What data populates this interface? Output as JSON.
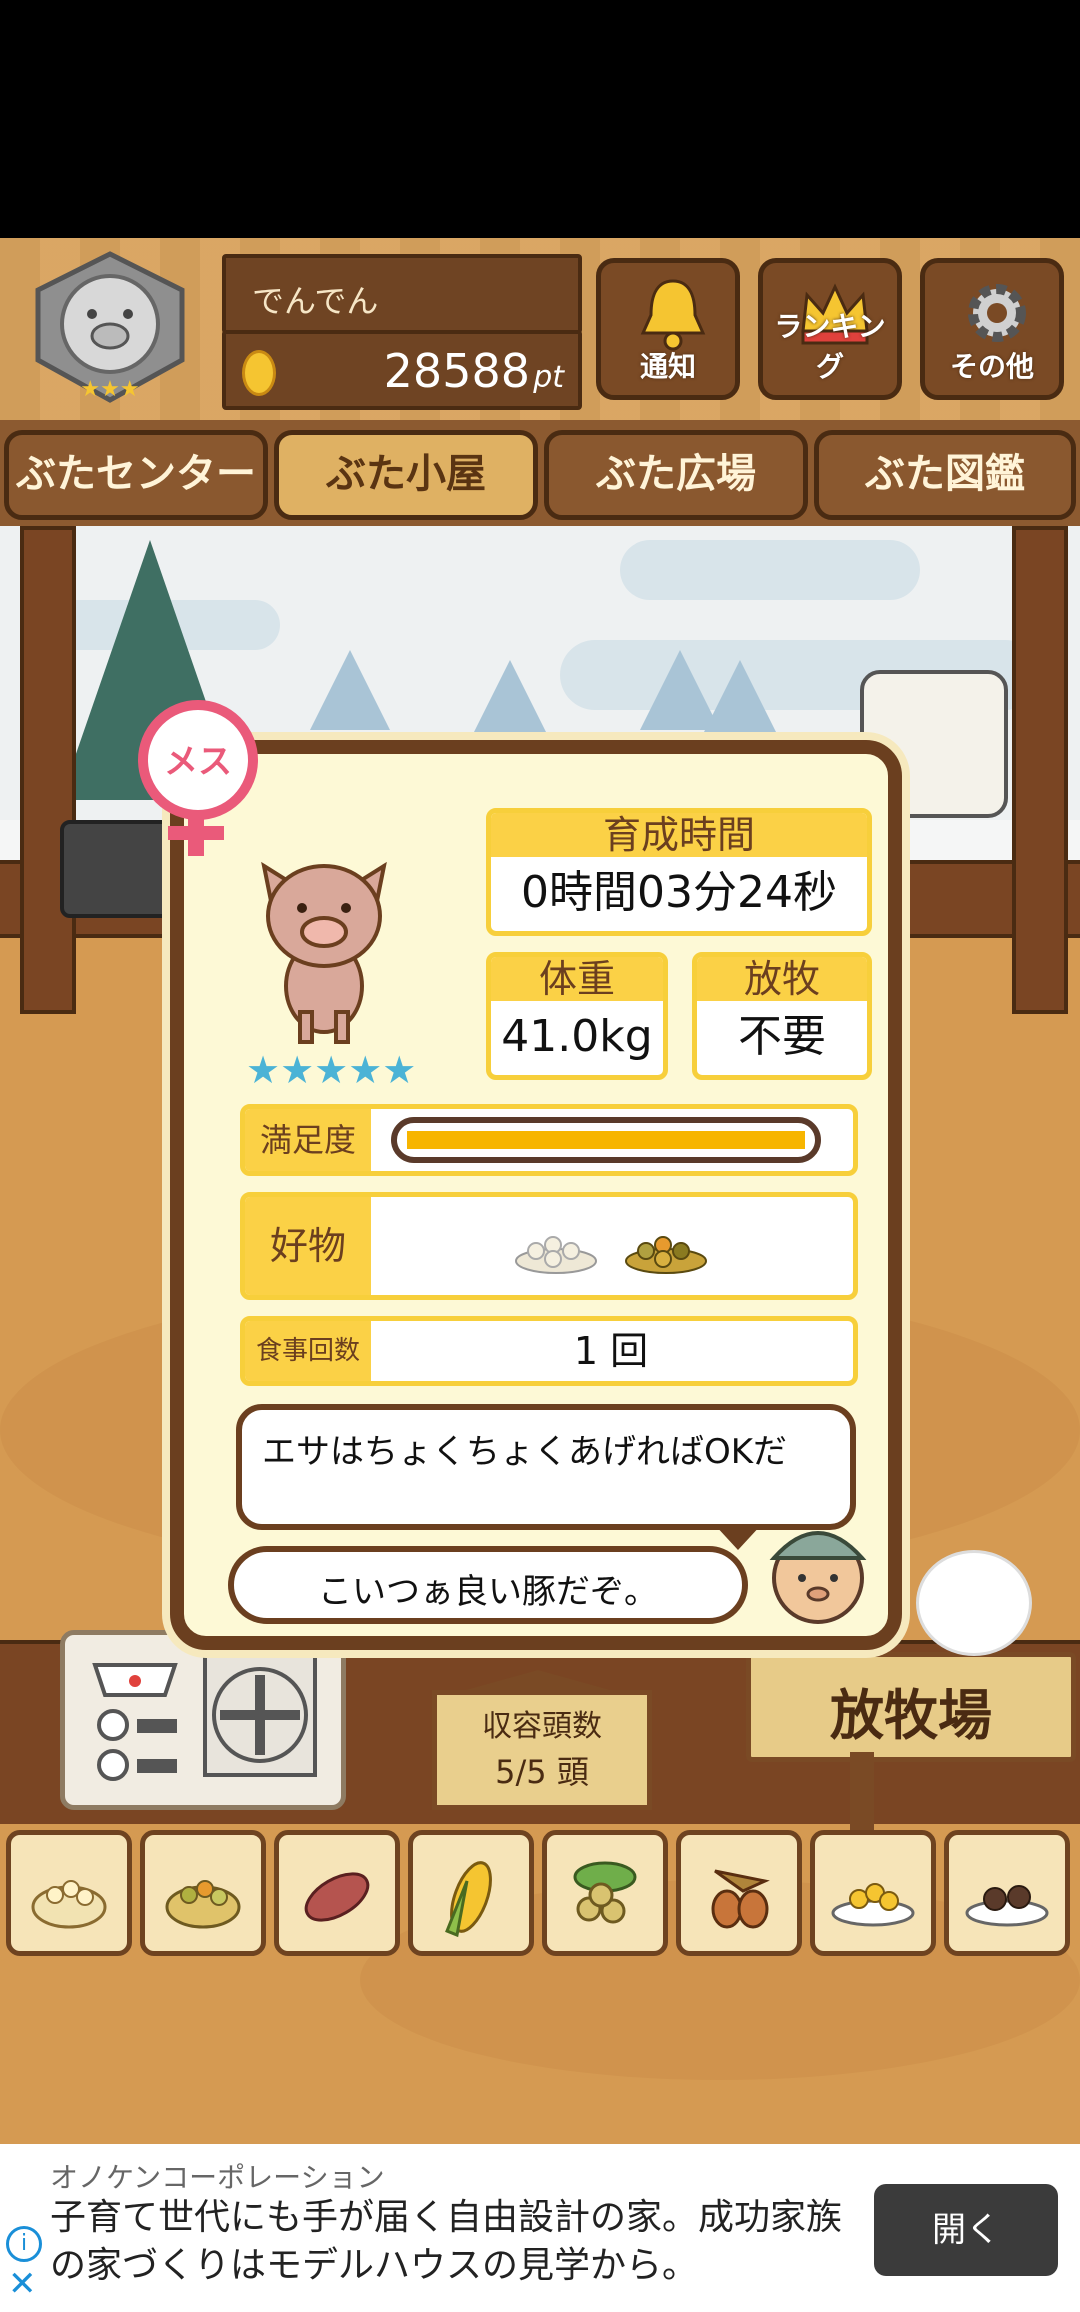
{
  "header": {
    "username": "でんでん",
    "points": "28588",
    "points_unit": "pt",
    "buttons": [
      {
        "label": "通知",
        "icon": "bell-icon"
      },
      {
        "label": "ランキング",
        "icon": "crown-icon"
      },
      {
        "label": "その他",
        "icon": "gear-icon"
      }
    ]
  },
  "tabs": [
    {
      "label": "ぶたセンター",
      "active": false
    },
    {
      "label": "ぶた小屋",
      "active": true
    },
    {
      "label": "ぶた広場",
      "active": false
    },
    {
      "label": "ぶた図鑑",
      "active": false
    }
  ],
  "pig_card": {
    "gender_label": "メス",
    "growth_time_label": "育成時間",
    "growth_time_value": "0時間03分24秒",
    "weight_label": "体重",
    "weight_value": "41.0kg",
    "grazing_label": "放牧",
    "grazing_value": "不要",
    "stars": "★★★★★",
    "satisfaction_label": "満足度",
    "satisfaction_level": 1.0,
    "favorite_label": "好物",
    "meal_count_label": "食事回数",
    "meal_count_value": "1 回",
    "advice_text": "エサはちょくちょくあげればOKだ",
    "farmer_comment": "こいつぁ良い豚だぞ。"
  },
  "scene": {
    "capacity_label": "収容頭数",
    "capacity_value": "5/5 頭",
    "pasture_label": "放牧場"
  },
  "food_items": [
    {
      "icon": "grain-pile-icon"
    },
    {
      "icon": "mixed-grain-icon"
    },
    {
      "icon": "sweet-potato-icon"
    },
    {
      "icon": "corn-icon"
    },
    {
      "icon": "beans-icon"
    },
    {
      "icon": "acorn-icon"
    },
    {
      "icon": "corn-plate-icon"
    },
    {
      "icon": "chestnut-plate-icon"
    }
  ],
  "ad": {
    "advertiser": "オノケンコーポレーション",
    "message": "子育て世代にも手が届く自由設計の家。成功家族の家づくりはモデルハウスの見学から。",
    "button": "開く"
  },
  "colors": {
    "wood": "#7a4a25",
    "yellow": "#fbd146",
    "gender_pink": "#ea5a7a",
    "star_blue": "#4bb3d6"
  }
}
